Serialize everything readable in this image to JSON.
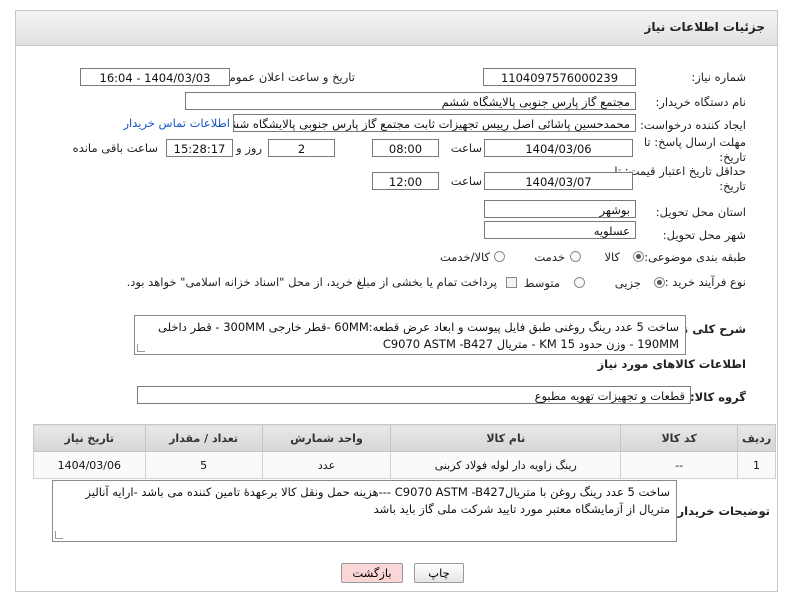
{
  "header": {
    "title": "جزئیات اطلاعات نیاز"
  },
  "form": {
    "need_number": {
      "label": "شماره نیاز:",
      "value": "1104097576000239"
    },
    "announce_datetime": {
      "label": "تاریخ و ساعت اعلان عمومی:",
      "value": "1404/03/03 - 16:04"
    },
    "buyer_org": {
      "label": "نام دستگاه خریدار:",
      "value": "مجتمع گاز پارس جنوبی  پالایشگاه ششم"
    },
    "requester": {
      "label": "ایجاد کننده درخواست:",
      "value": "محمدحسین پاشائی اصل رییس تجهیزات ثابت مجتمع گاز پارس جنوبی  پالایشگاه ششم",
      "contact_link": "اطلاعات تماس خریدار"
    },
    "reply_deadline": {
      "label": "مهلت ارسال پاسخ: تا تاریخ:",
      "date": "1404/03/06",
      "time_label": "ساعت",
      "time": "08:00",
      "days": "2",
      "days_label": "روز و",
      "remaining": "15:28:17",
      "remaining_label": "ساعت باقی مانده"
    },
    "price_validity": {
      "label": "حداقل تاریخ اعتبار قیمت: تا تاریخ:",
      "date": "1404/03/07",
      "time_label": "ساعت",
      "time": "12:00"
    },
    "province": {
      "label": "استان محل تحویل:",
      "value": "بوشهر"
    },
    "city": {
      "label": "شهر محل تحویل:",
      "value": "عسلویه"
    },
    "category": {
      "label": "طبقه بندی موضوعی:",
      "options": [
        "کالا",
        "خدمت",
        "کالا/خدمت"
      ],
      "selected": 0
    },
    "process": {
      "label": "نوع فرآیند خرید :",
      "options": [
        "جزیی",
        "متوسط"
      ],
      "selected": 0,
      "note": "پرداخت تمام یا بخشی از مبلغ خرید، از محل \"اسناد خزانه اسلامی\" خواهد بود."
    },
    "description": {
      "label": "شرح کلی نیاز:",
      "line1": "ساخت 5 عدد رینگ روغنی طبق فایل پیوست و ابعاد عرض قطعه:60MM -قطر خارجی 300MM - قطر داخلی",
      "line2": "190MM - وزن حدود 15 KM  -   متریال C9070  ASTM -B427"
    }
  },
  "goods": {
    "section_title": "اطلاعات کالاهای مورد نیاز",
    "group_label": "گروه کالا:",
    "group_value": "قطعات و تجهیزات تهویه مطبوع",
    "columns": [
      "ردیف",
      "کد کالا",
      "نام کالا",
      "واحد شمارش",
      "تعداد / مقدار",
      "تاریخ نیاز"
    ],
    "rows": [
      {
        "row": "1",
        "code": "--",
        "name": "رینگ زاویه دار لوله فولاد کربنی",
        "unit": "عدد",
        "qty": "5",
        "date": "1404/03/06"
      }
    ]
  },
  "buyer_notes": {
    "label": "توضیحات خریدار:",
    "line1": "ساخت 5 عدد رینگ روغن با متریالC9070  ASTM -B427  ---هزینه حمل ونقل کالا برعهدهٔ تامین کننده می باشد -ارایه آنالیز",
    "line2": "متریال از آزمایشگاه معتبر مورد تایید شرکت ملی گاز باید باشد"
  },
  "buttons": {
    "print": "چاپ",
    "back": "بازگشت"
  },
  "colors": {
    "back_button_bg": "#fbd6d6",
    "link": "#1a55c4"
  }
}
